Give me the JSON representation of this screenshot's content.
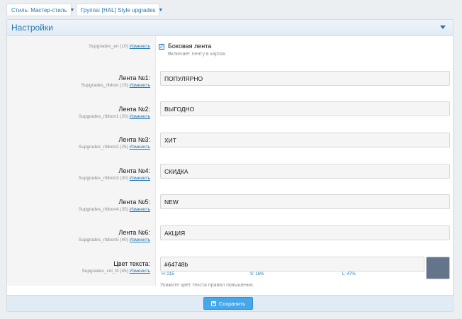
{
  "toolbar": {
    "style_label": "Стиль: Мастер-стиль",
    "group_label": "Группа: [HAL] Style upgrades"
  },
  "panel": {
    "title": "Настройки"
  },
  "sidebar_option": {
    "id_text": "Supgrades_en (10)",
    "edit_label": "Изменить",
    "checkbox_label": "Боковая лента",
    "checkbox_checked": true,
    "description": "Включает ленту в картах."
  },
  "ribbons": [
    {
      "label": "Лента №1:",
      "id_text": "Supgrades_ribbon (15)",
      "edit_label": "Изменить",
      "value": "ПОПУЛЯРНО"
    },
    {
      "label": "Лента №2:",
      "id_text": "Supgrades_ribbon1 (20)",
      "edit_label": "Изменить",
      "value": "ВЫГОДНО"
    },
    {
      "label": "Лента №3:",
      "id_text": "Supgrades_ribbon2 (25)",
      "edit_label": "Изменить",
      "value": "ХИТ"
    },
    {
      "label": "Лента №4:",
      "id_text": "Supgrades_ribbon3 (30)",
      "edit_label": "Изменить",
      "value": "СКИДКА"
    },
    {
      "label": "Лента №5:",
      "id_text": "Supgrades_ribbon4 (35)",
      "edit_label": "Изменить",
      "value": "NEW"
    },
    {
      "label": "Лента №6:",
      "id_text": "Supgrades_ribbon5 (40)",
      "edit_label": "Изменить",
      "value": "АКЦИЯ"
    }
  ],
  "text_color": {
    "label": "Цвет текста:",
    "id_text": "Supgrades_col_tit (45)",
    "edit_label": "Изменить",
    "value": "#64748b",
    "h": "H: 215",
    "s": "S: 16%",
    "l": "L: 47%",
    "hint": "Укажите цвет текста правил повышения.",
    "swatch_color": "#64748b"
  },
  "footer": {
    "save_label": "Сохранить"
  },
  "colors": {
    "accent": "#2577b1",
    "button": "#47a7eb"
  }
}
